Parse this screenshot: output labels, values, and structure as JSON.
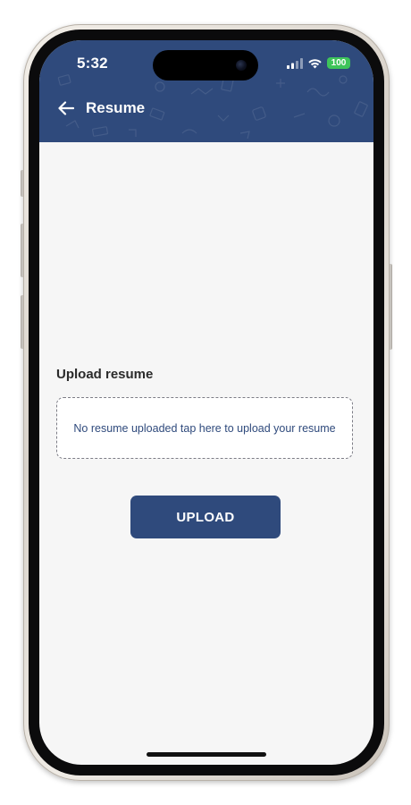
{
  "status_bar": {
    "time": "5:32",
    "battery": "100",
    "icons": [
      "signal-icon",
      "wifi-icon",
      "battery-icon"
    ]
  },
  "header": {
    "back_icon": "arrow-left-icon",
    "title": "Resume"
  },
  "form": {
    "label": "Upload resume",
    "drop_zone_text": "No resume uploaded tap here to upload your resume",
    "upload_button": "UPLOAD"
  },
  "colors": {
    "primary": "#2f4a7c",
    "background": "#f6f6f6",
    "battery": "#3ec45a"
  }
}
